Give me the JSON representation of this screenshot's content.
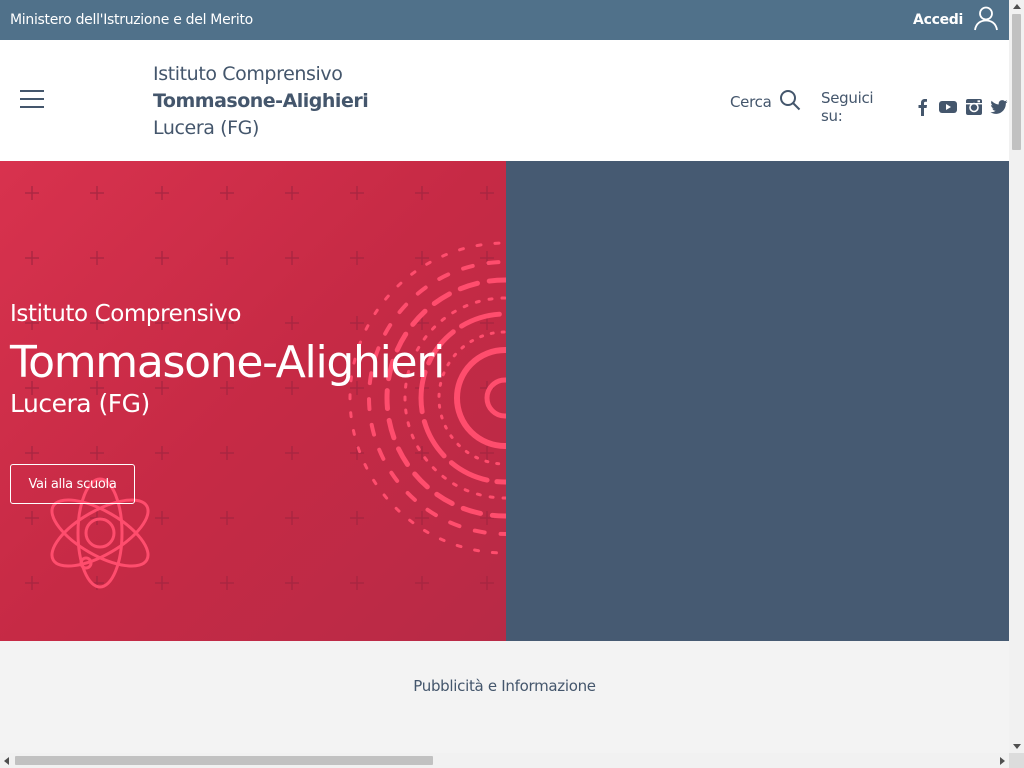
{
  "topbar": {
    "ministry": "Ministero dell'Istruzione e del Merito",
    "login_label": "Accedi",
    "login_icon": "user-icon"
  },
  "header": {
    "menu_icon": "hamburger-icon",
    "school_type": "Istituto Comprensivo",
    "school_name": "Tommasone-Alighieri",
    "school_city": "Lucera (FG)",
    "search_label": "Cerca",
    "search_icon": "search-icon",
    "social_label": "Seguici su:",
    "social": [
      {
        "name": "facebook-icon"
      },
      {
        "name": "youtube-icon"
      },
      {
        "name": "instagram-icon"
      },
      {
        "name": "twitter-icon"
      }
    ]
  },
  "hero": {
    "subtitle": "Istituto Comprensivo",
    "title": "Tommasone-Alighieri",
    "city": "Lucera (FG)",
    "button_label": "Vai alla scuola"
  },
  "notice": {
    "text": "Pubblicità e Informazione"
  },
  "colors": {
    "topbar": "#50718a",
    "text": "#44566c",
    "hero_red": "#d8324e",
    "hero_blue": "#465a72",
    "accent_pink": "#ff4d6d"
  }
}
